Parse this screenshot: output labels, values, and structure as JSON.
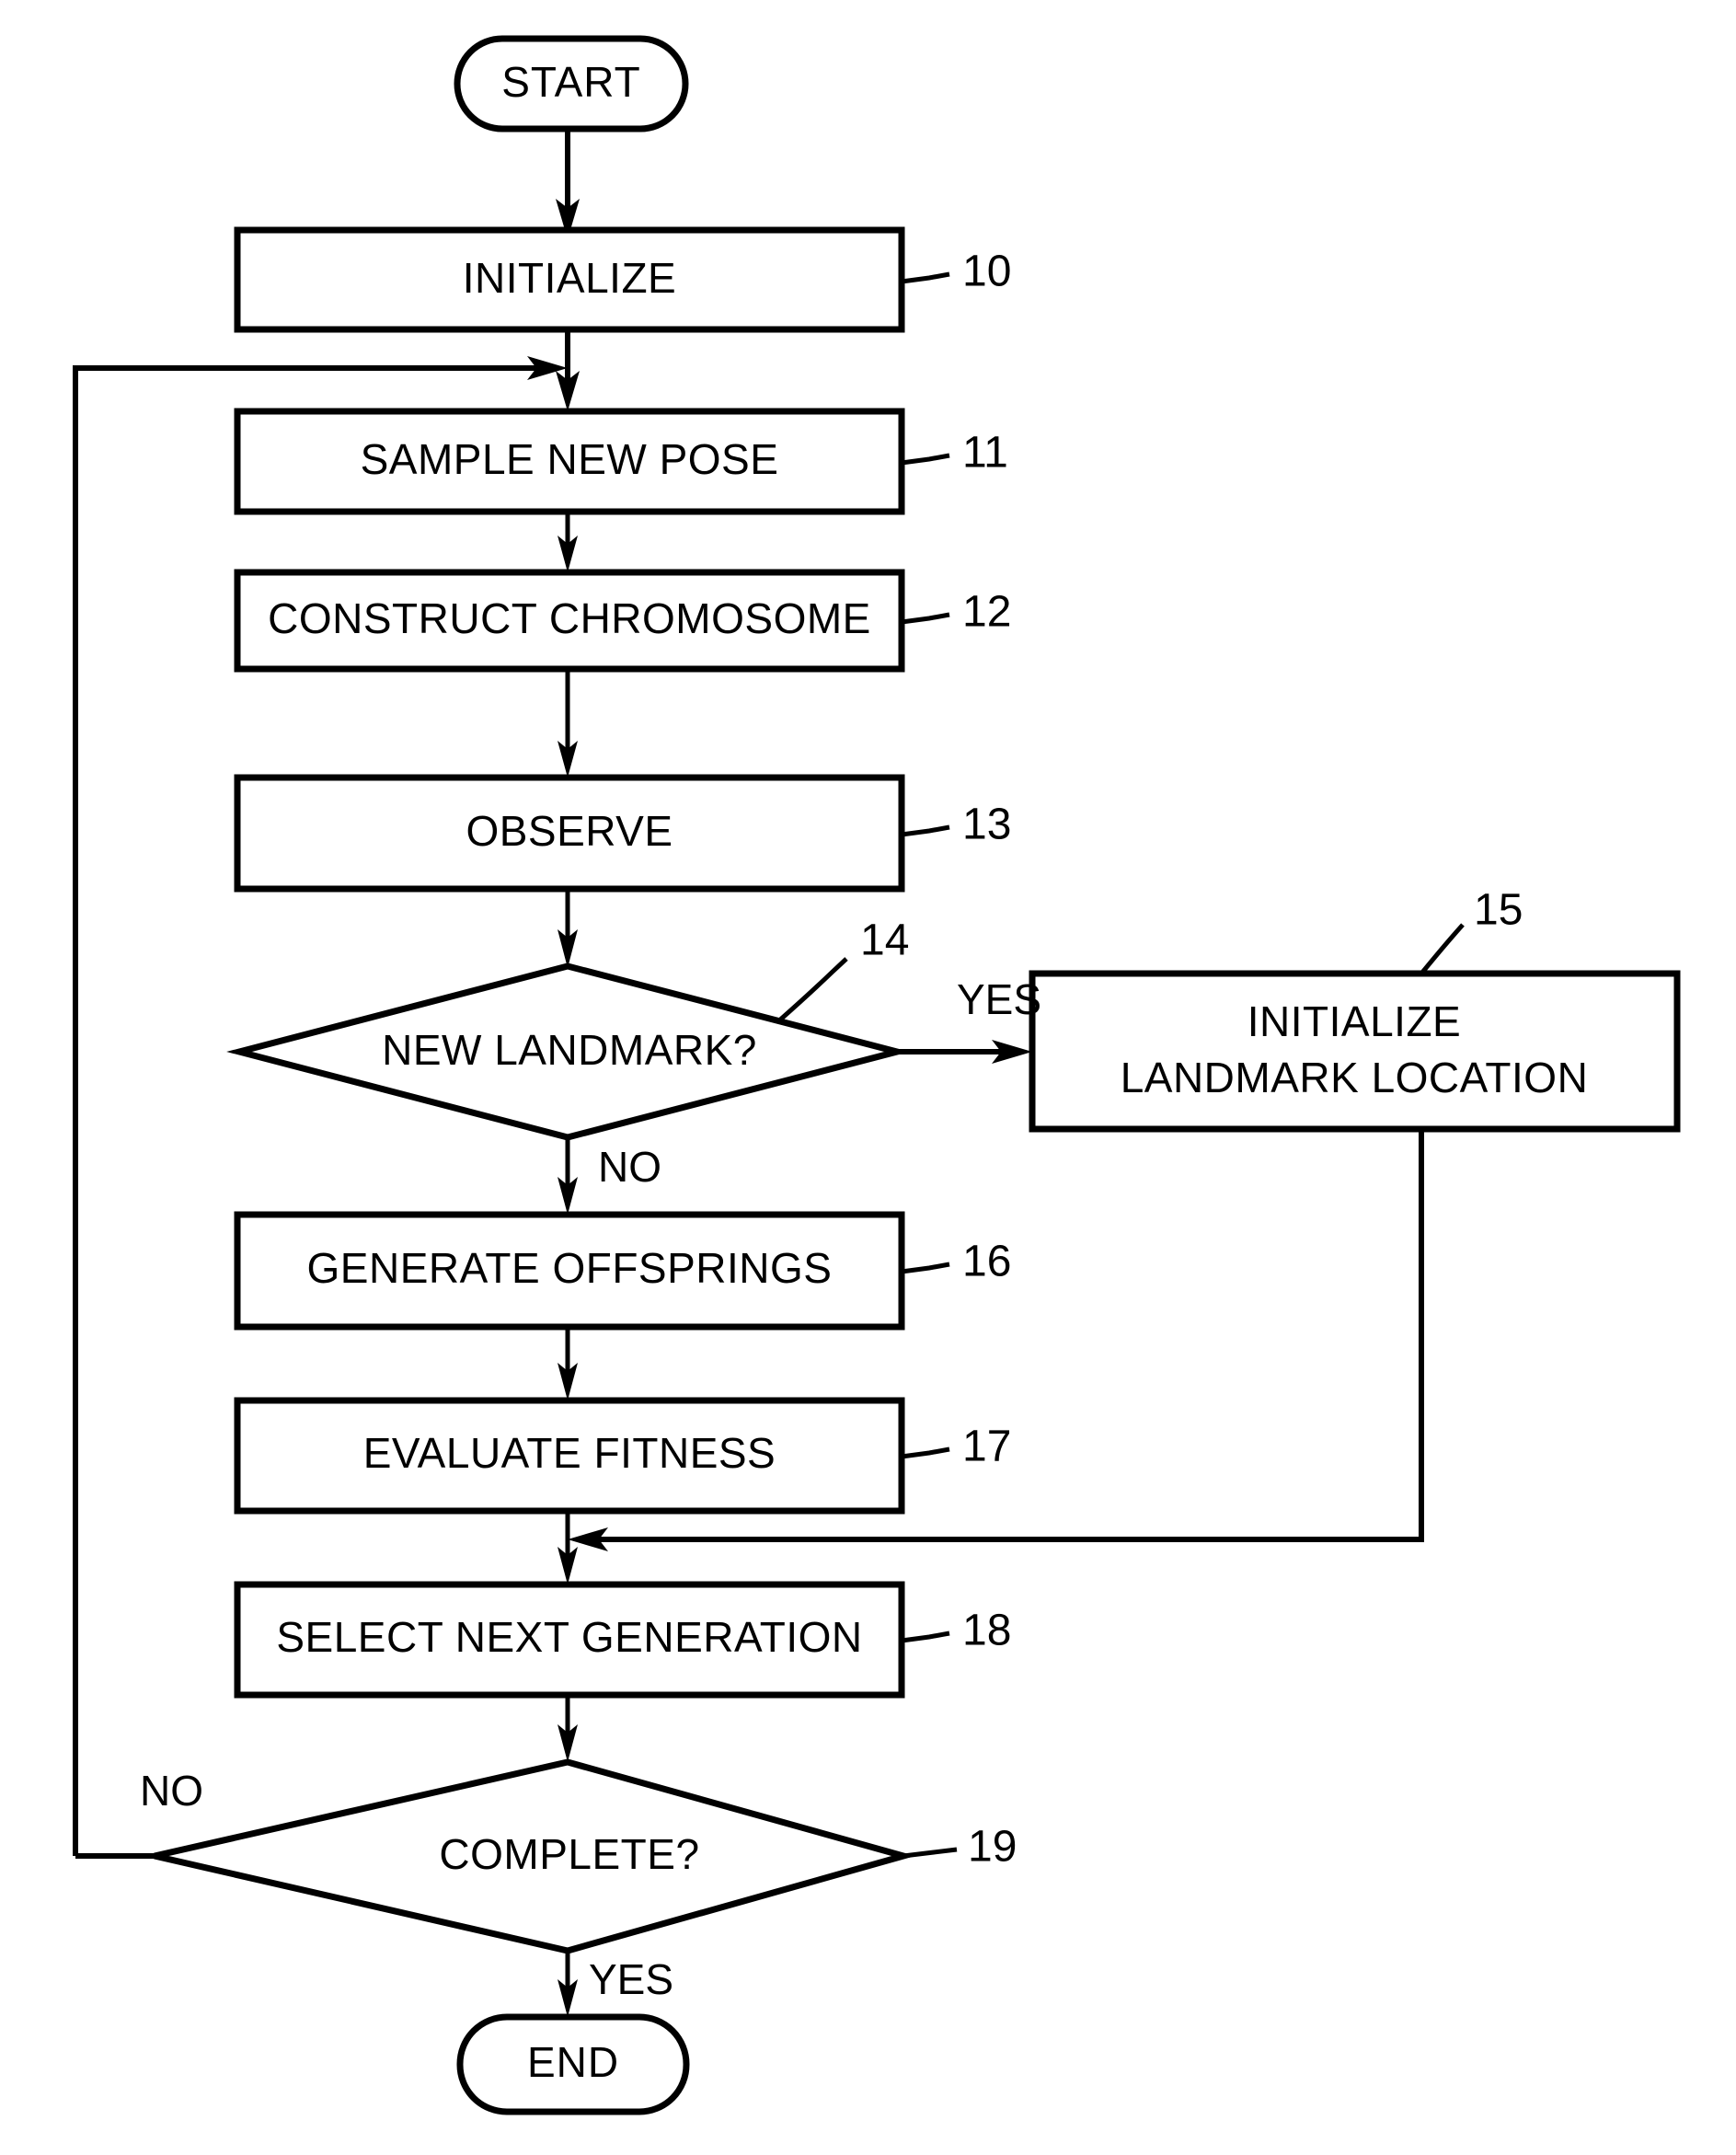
{
  "diagram": {
    "title": "Flowchart",
    "colors": {
      "stroke": "#000000",
      "fill": "#ffffff",
      "text": "#000000"
    },
    "nodes": {
      "start": {
        "label": "START",
        "shape": "terminator"
      },
      "end": {
        "label": "END",
        "shape": "terminator"
      },
      "n10": {
        "label": "INITIALIZE",
        "ref": "10",
        "shape": "process"
      },
      "n11": {
        "label": "SAMPLE NEW POSE",
        "ref": "11",
        "shape": "process"
      },
      "n12": {
        "label": "CONSTRUCT CHROMOSOME",
        "ref": "12",
        "shape": "process"
      },
      "n13": {
        "label": "OBSERVE",
        "ref": "13",
        "shape": "process"
      },
      "n14": {
        "label": "NEW LANDMARK?",
        "ref": "14",
        "shape": "decision"
      },
      "n15": {
        "label_line1": "INITIALIZE",
        "label_line2": "LANDMARK LOCATION",
        "ref": "15",
        "shape": "process"
      },
      "n16": {
        "label": "GENERATE OFFSPRINGS",
        "ref": "16",
        "shape": "process"
      },
      "n17": {
        "label": "EVALUATE FITNESS",
        "ref": "17",
        "shape": "process"
      },
      "n18": {
        "label": "SELECT NEXT GENERATION",
        "ref": "18",
        "shape": "process"
      },
      "n19": {
        "label": "COMPLETE?",
        "ref": "19",
        "shape": "decision"
      }
    },
    "edge_labels": {
      "yes_landmark": "YES",
      "no_landmark": "NO",
      "no_complete": "NO",
      "yes_complete": "YES"
    }
  }
}
